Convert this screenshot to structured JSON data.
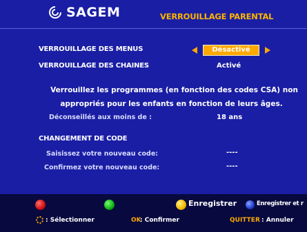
{
  "header": {
    "brand": "SAGEM",
    "title": "VERROUILLAGE PARENTAL"
  },
  "settings": {
    "menus_label": "VERROUILLAGE DES MENUS",
    "menus_value": "Désactivé",
    "chaines_label": "VERROUILLAGE DES CHAINES",
    "chaines_value": "Activé"
  },
  "info": {
    "line1": "Verrouillez les programmes (en fonction des codes CSA) non",
    "line2": "appropriés pour les enfants en fonction de leurs âges."
  },
  "age": {
    "label": "Déconseillés aux moins de :",
    "value": "18 ans"
  },
  "code": {
    "heading": "CHANGEMENT DE CODE",
    "new_label": "Saisissez votre nouveau code:",
    "new_value": "----",
    "confirm_label": "Confirmez votre nouveau code:",
    "confirm_value": "----"
  },
  "footer": {
    "yellow_label": "Enregistrer",
    "blue_label": "Enregistrer et r",
    "nav_hint": ": Sélectionner",
    "ok_key": "OK",
    "ok_hint": ": Confirmer",
    "quit_key": "QUITTER",
    "quit_hint": ": Annuler"
  },
  "colors": {
    "background": "#1a1ea4",
    "accent": "#ffa800",
    "title": "#ffb400",
    "footer": "#07093f"
  }
}
